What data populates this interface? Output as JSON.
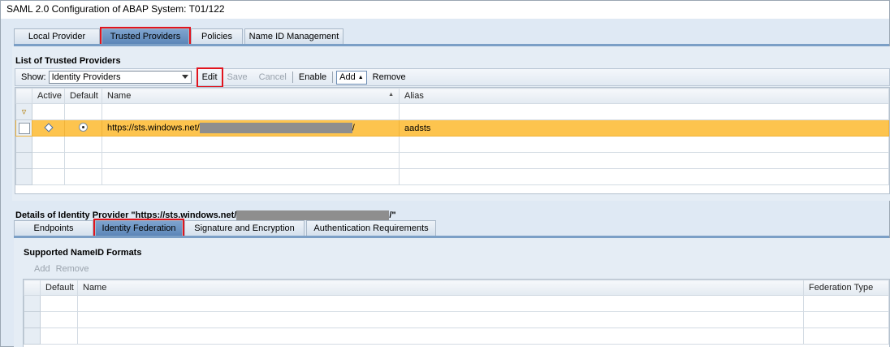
{
  "window": {
    "title": "SAML 2.0 Configuration of ABAP System: T01/122"
  },
  "top_tabs": [
    {
      "label": "Local Provider",
      "active": false
    },
    {
      "label": "Trusted Providers",
      "active": true
    },
    {
      "label": "Policies",
      "active": false
    },
    {
      "label": "Name ID Management",
      "active": false
    }
  ],
  "trusted": {
    "section_title": "List of Trusted Providers",
    "show_label": "Show:",
    "show_value": "Identity Providers",
    "toolbar": {
      "edit": "Edit",
      "save": "Save",
      "cancel": "Cancel",
      "enable": "Enable",
      "add": "Add",
      "remove": "Remove"
    },
    "columns": {
      "active": "Active",
      "default": "Default",
      "name": "Name",
      "alias": "Alias"
    },
    "rows": [
      {
        "name_prefix": "https://sts.windows.net/",
        "name_suffix": "/",
        "alias": "aadsts"
      }
    ]
  },
  "details": {
    "title_prefix": "Details of Identity Provider \"https://sts.windows.net/",
    "title_suffix": "/\"",
    "tabs": [
      {
        "label": "Endpoints",
        "active": false
      },
      {
        "label": "Identity Federation",
        "active": true
      },
      {
        "label": "Signature and Encryption",
        "active": false
      },
      {
        "label": "Authentication Requirements",
        "active": false
      }
    ],
    "nameid": {
      "section_title": "Supported NameID Formats",
      "toolbar": {
        "add": "Add",
        "remove": "Remove"
      },
      "columns": {
        "default": "Default",
        "name": "Name",
        "federation_type": "Federation Type"
      }
    }
  },
  "colors": {
    "highlight_row": "#fdc44e",
    "active_tab": "#6b93c3",
    "annotation_red": "#e1141e"
  }
}
